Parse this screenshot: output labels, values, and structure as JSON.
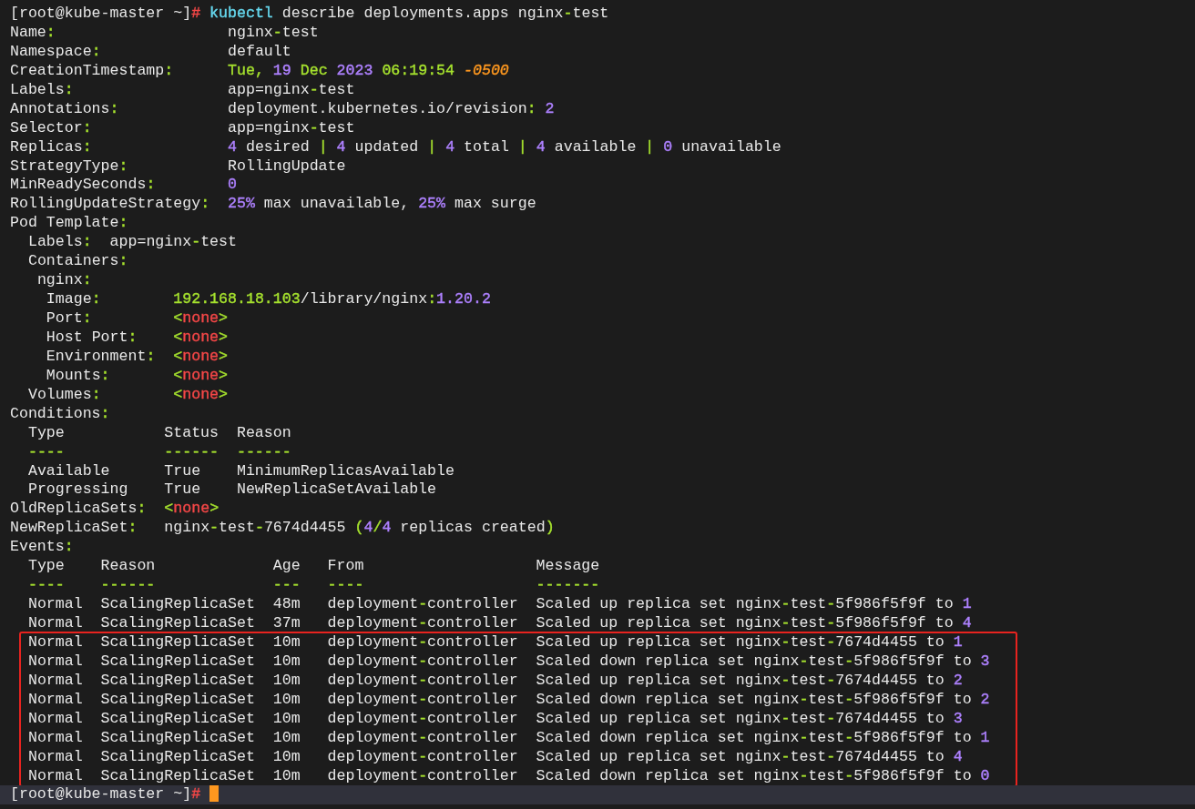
{
  "lines": [
    [
      {
        "text": "[root@kube-master ~]"
      },
      {
        "text": "# ",
        "color": "#f44747"
      },
      {
        "text": "kubectl",
        "color": "#66d9ef"
      },
      {
        "text": " describe deployments.apps nginx"
      },
      {
        "text": "-",
        "color": "#a6e22e"
      },
      {
        "text": "test"
      }
    ],
    [
      {
        "text": "Name"
      },
      {
        "text": ":",
        "color": "#a6e22e"
      },
      {
        "text": "                   nginx"
      },
      {
        "text": "-",
        "color": "#a6e22e"
      },
      {
        "text": "test"
      }
    ],
    [
      {
        "text": "Namespace"
      },
      {
        "text": ":",
        "color": "#a6e22e"
      },
      {
        "text": "              default"
      }
    ],
    [
      {
        "text": "CreationTimestamp"
      },
      {
        "text": ":      ",
        "color": "#a6e22e"
      },
      {
        "text": "Tue, ",
        "color": "#a6e22e"
      },
      {
        "text": "19",
        "color": "#ae81ff"
      },
      {
        "text": " Dec ",
        "color": "#a6e22e"
      },
      {
        "text": "2023",
        "color": "#ae81ff"
      },
      {
        "text": " 06:19:54 ",
        "color": "#a6e22e"
      },
      {
        "text": "-0500",
        "color": "#fd971f",
        "italic": true
      }
    ],
    [
      {
        "text": "Labels"
      },
      {
        "text": ":",
        "color": "#a6e22e"
      },
      {
        "text": "                 app=nginx"
      },
      {
        "text": "-",
        "color": "#a6e22e"
      },
      {
        "text": "test"
      }
    ],
    [
      {
        "text": "Annotations"
      },
      {
        "text": ":",
        "color": "#a6e22e"
      },
      {
        "text": "            deployment.kubernetes.io/revision"
      },
      {
        "text": ": ",
        "color": "#a6e22e"
      },
      {
        "text": "2",
        "color": "#ae81ff"
      }
    ],
    [
      {
        "text": "Selector"
      },
      {
        "text": ":",
        "color": "#a6e22e"
      },
      {
        "text": "               app=nginx"
      },
      {
        "text": "-",
        "color": "#a6e22e"
      },
      {
        "text": "test"
      }
    ],
    [
      {
        "text": "Replicas"
      },
      {
        "text": ":               ",
        "color": "#a6e22e"
      },
      {
        "text": "4",
        "color": "#ae81ff"
      },
      {
        "text": " desired "
      },
      {
        "text": "| ",
        "color": "#a6e22e"
      },
      {
        "text": "4",
        "color": "#ae81ff"
      },
      {
        "text": " updated "
      },
      {
        "text": "| ",
        "color": "#a6e22e"
      },
      {
        "text": "4",
        "color": "#ae81ff"
      },
      {
        "text": " total "
      },
      {
        "text": "| ",
        "color": "#a6e22e"
      },
      {
        "text": "4",
        "color": "#ae81ff"
      },
      {
        "text": " available "
      },
      {
        "text": "| ",
        "color": "#a6e22e"
      },
      {
        "text": "0",
        "color": "#ae81ff"
      },
      {
        "text": " unavailable"
      }
    ],
    [
      {
        "text": "StrategyType"
      },
      {
        "text": ":",
        "color": "#a6e22e"
      },
      {
        "text": "           RollingUpdate"
      }
    ],
    [
      {
        "text": "MinReadySeconds"
      },
      {
        "text": ":        ",
        "color": "#a6e22e"
      },
      {
        "text": "0",
        "color": "#ae81ff"
      }
    ],
    [
      {
        "text": "RollingUpdateStrategy"
      },
      {
        "text": ":  ",
        "color": "#a6e22e"
      },
      {
        "text": "25%",
        "color": "#ae81ff"
      },
      {
        "text": " max unavailable, "
      },
      {
        "text": "25%",
        "color": "#ae81ff"
      },
      {
        "text": " max surge"
      }
    ],
    [
      {
        "text": "Pod Template"
      },
      {
        "text": ":",
        "color": "#a6e22e"
      }
    ],
    [
      {
        "text": "  Labels"
      },
      {
        "text": ":",
        "color": "#a6e22e"
      },
      {
        "text": "  app=nginx"
      },
      {
        "text": "-",
        "color": "#a6e22e"
      },
      {
        "text": "test"
      }
    ],
    [
      {
        "text": "  Containers"
      },
      {
        "text": ":",
        "color": "#a6e22e"
      }
    ],
    [
      {
        "text": "   nginx"
      },
      {
        "text": ":",
        "color": "#a6e22e"
      }
    ],
    [
      {
        "text": "    Image"
      },
      {
        "text": ":",
        "color": "#a6e22e"
      },
      {
        "text": "        192.168.18.103",
        "color": "#a6e22e"
      },
      {
        "text": "/library/nginx"
      },
      {
        "text": ":",
        "color": "#a6e22e"
      },
      {
        "text": "1.20.2",
        "color": "#ae81ff"
      }
    ],
    [
      {
        "text": "    Port"
      },
      {
        "text": ":",
        "color": "#a6e22e"
      },
      {
        "text": "         <",
        "color": "#a6e22e"
      },
      {
        "text": "none",
        "color": "#f44747"
      },
      {
        "text": ">",
        "color": "#a6e22e"
      }
    ],
    [
      {
        "text": "    Host Port"
      },
      {
        "text": ":",
        "color": "#a6e22e"
      },
      {
        "text": "    <",
        "color": "#a6e22e"
      },
      {
        "text": "none",
        "color": "#f44747"
      },
      {
        "text": ">",
        "color": "#a6e22e"
      }
    ],
    [
      {
        "text": "    Environment"
      },
      {
        "text": ":",
        "color": "#a6e22e"
      },
      {
        "text": "  <",
        "color": "#a6e22e"
      },
      {
        "text": "none",
        "color": "#f44747"
      },
      {
        "text": ">",
        "color": "#a6e22e"
      }
    ],
    [
      {
        "text": "    Mounts"
      },
      {
        "text": ":",
        "color": "#a6e22e"
      },
      {
        "text": "       <",
        "color": "#a6e22e"
      },
      {
        "text": "none",
        "color": "#f44747"
      },
      {
        "text": ">",
        "color": "#a6e22e"
      }
    ],
    [
      {
        "text": "  Volumes"
      },
      {
        "text": ":",
        "color": "#a6e22e"
      },
      {
        "text": "        <",
        "color": "#a6e22e"
      },
      {
        "text": "none",
        "color": "#f44747"
      },
      {
        "text": ">",
        "color": "#a6e22e"
      }
    ],
    [
      {
        "text": "Conditions"
      },
      {
        "text": ":",
        "color": "#a6e22e"
      }
    ],
    [
      {
        "text": "  Type           Status  Reason"
      }
    ],
    [
      {
        "text": "  ----           ------  ------",
        "color": "#a6e22e"
      }
    ],
    [
      {
        "text": "  Available      True    MinimumReplicasAvailable"
      }
    ],
    [
      {
        "text": "  Progressing    True    NewReplicaSetAvailable"
      }
    ],
    [
      {
        "text": "OldReplicaSets"
      },
      {
        "text": ":",
        "color": "#a6e22e"
      },
      {
        "text": "  <",
        "color": "#a6e22e"
      },
      {
        "text": "none",
        "color": "#f44747"
      },
      {
        "text": ">",
        "color": "#a6e22e"
      }
    ],
    [
      {
        "text": "NewReplicaSet"
      },
      {
        "text": ":",
        "color": "#a6e22e"
      },
      {
        "text": "   nginx"
      },
      {
        "text": "-",
        "color": "#a6e22e"
      },
      {
        "text": "test"
      },
      {
        "text": "-",
        "color": "#a6e22e"
      },
      {
        "text": "7674d4455 "
      },
      {
        "text": "(",
        "color": "#a6e22e"
      },
      {
        "text": "4",
        "color": "#ae81ff"
      },
      {
        "text": "/",
        "color": "#a6e22e"
      },
      {
        "text": "4",
        "color": "#ae81ff"
      },
      {
        "text": " replicas created"
      },
      {
        "text": ")",
        "color": "#a6e22e"
      }
    ],
    [
      {
        "text": "Events"
      },
      {
        "text": ":",
        "color": "#a6e22e"
      }
    ],
    [
      {
        "text": "  Type    Reason             Age   From                   Message"
      }
    ],
    [
      {
        "text": "  ----    ------             ---   ----                   -------",
        "color": "#a6e22e"
      }
    ]
  ],
  "event_rows": [
    {
      "highlighted": false,
      "segments": [
        {
          "text": "  Normal  ScalingReplicaSet  48m   deployment"
        },
        {
          "text": "-",
          "color": "#a6e22e"
        },
        {
          "text": "controller  Scaled up replica set nginx"
        },
        {
          "text": "-",
          "color": "#a6e22e"
        },
        {
          "text": "test"
        },
        {
          "text": "-",
          "color": "#a6e22e"
        },
        {
          "text": "5f986f5f9f to "
        },
        {
          "text": "1",
          "color": "#ae81ff"
        }
      ]
    },
    {
      "highlighted": false,
      "segments": [
        {
          "text": "  Normal  ScalingReplicaSet  37m   deployment"
        },
        {
          "text": "-",
          "color": "#a6e22e"
        },
        {
          "text": "controller  Scaled up replica set nginx"
        },
        {
          "text": "-",
          "color": "#a6e22e"
        },
        {
          "text": "test"
        },
        {
          "text": "-",
          "color": "#a6e22e"
        },
        {
          "text": "5f986f5f9f to "
        },
        {
          "text": "4",
          "color": "#ae81ff"
        }
      ]
    },
    {
      "highlighted": true,
      "segments": [
        {
          "text": "  Normal  ScalingReplicaSet  10m   deployment"
        },
        {
          "text": "-",
          "color": "#a6e22e"
        },
        {
          "text": "controller  Scaled up replica set nginx"
        },
        {
          "text": "-",
          "color": "#a6e22e"
        },
        {
          "text": "test"
        },
        {
          "text": "-",
          "color": "#a6e22e"
        },
        {
          "text": "7674d4455 to "
        },
        {
          "text": "1",
          "color": "#ae81ff"
        }
      ]
    },
    {
      "highlighted": true,
      "segments": [
        {
          "text": "  Normal  ScalingReplicaSet  10m   deployment"
        },
        {
          "text": "-",
          "color": "#a6e22e"
        },
        {
          "text": "controller  Scaled down replica set nginx"
        },
        {
          "text": "-",
          "color": "#a6e22e"
        },
        {
          "text": "test"
        },
        {
          "text": "-",
          "color": "#a6e22e"
        },
        {
          "text": "5f986f5f9f to "
        },
        {
          "text": "3",
          "color": "#ae81ff"
        }
      ]
    },
    {
      "highlighted": true,
      "segments": [
        {
          "text": "  Normal  ScalingReplicaSet  10m   deployment"
        },
        {
          "text": "-",
          "color": "#a6e22e"
        },
        {
          "text": "controller  Scaled up replica set nginx"
        },
        {
          "text": "-",
          "color": "#a6e22e"
        },
        {
          "text": "test"
        },
        {
          "text": "-",
          "color": "#a6e22e"
        },
        {
          "text": "7674d4455 to "
        },
        {
          "text": "2",
          "color": "#ae81ff"
        }
      ]
    },
    {
      "highlighted": true,
      "segments": [
        {
          "text": "  Normal  ScalingReplicaSet  10m   deployment"
        },
        {
          "text": "-",
          "color": "#a6e22e"
        },
        {
          "text": "controller  Scaled down replica set nginx"
        },
        {
          "text": "-",
          "color": "#a6e22e"
        },
        {
          "text": "test"
        },
        {
          "text": "-",
          "color": "#a6e22e"
        },
        {
          "text": "5f986f5f9f to "
        },
        {
          "text": "2",
          "color": "#ae81ff"
        }
      ]
    },
    {
      "highlighted": true,
      "segments": [
        {
          "text": "  Normal  ScalingReplicaSet  10m   deployment"
        },
        {
          "text": "-",
          "color": "#a6e22e"
        },
        {
          "text": "controller  Scaled up replica set nginx"
        },
        {
          "text": "-",
          "color": "#a6e22e"
        },
        {
          "text": "test"
        },
        {
          "text": "-",
          "color": "#a6e22e"
        },
        {
          "text": "7674d4455 to "
        },
        {
          "text": "3",
          "color": "#ae81ff"
        }
      ]
    },
    {
      "highlighted": true,
      "segments": [
        {
          "text": "  Normal  ScalingReplicaSet  10m   deployment"
        },
        {
          "text": "-",
          "color": "#a6e22e"
        },
        {
          "text": "controller  Scaled down replica set nginx"
        },
        {
          "text": "-",
          "color": "#a6e22e"
        },
        {
          "text": "test"
        },
        {
          "text": "-",
          "color": "#a6e22e"
        },
        {
          "text": "5f986f5f9f to "
        },
        {
          "text": "1",
          "color": "#ae81ff"
        }
      ]
    },
    {
      "highlighted": true,
      "segments": [
        {
          "text": "  Normal  ScalingReplicaSet  10m   deployment"
        },
        {
          "text": "-",
          "color": "#a6e22e"
        },
        {
          "text": "controller  Scaled up replica set nginx"
        },
        {
          "text": "-",
          "color": "#a6e22e"
        },
        {
          "text": "test"
        },
        {
          "text": "-",
          "color": "#a6e22e"
        },
        {
          "text": "7674d4455 to "
        },
        {
          "text": "4",
          "color": "#ae81ff"
        }
      ]
    },
    {
      "highlighted": true,
      "segments": [
        {
          "text": "  Normal  ScalingReplicaSet  10m   deployment"
        },
        {
          "text": "-",
          "color": "#a6e22e"
        },
        {
          "text": "controller  Scaled down replica set nginx"
        },
        {
          "text": "-",
          "color": "#a6e22e"
        },
        {
          "text": "test"
        },
        {
          "text": "-",
          "color": "#a6e22e"
        },
        {
          "text": "5f986f5f9f to "
        },
        {
          "text": "0",
          "color": "#ae81ff"
        }
      ]
    }
  ],
  "prompt": {
    "current_line": true,
    "cursor": true,
    "segments": [
      {
        "text": "[root@kube-master ~]"
      },
      {
        "text": "# ",
        "color": "#f44747"
      }
    ]
  }
}
